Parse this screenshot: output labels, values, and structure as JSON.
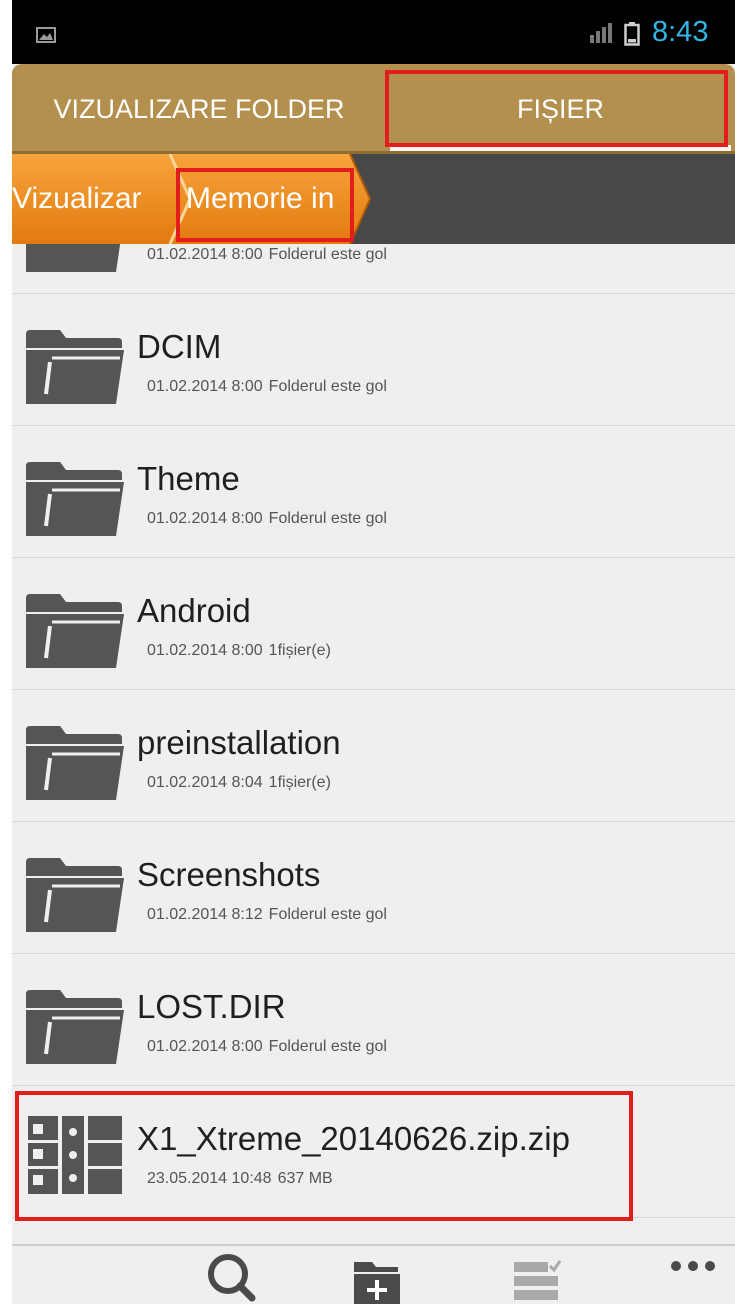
{
  "status_bar": {
    "time": "8:43"
  },
  "tabs": [
    {
      "label": "VIZUALIZARE FOLDER",
      "active": false
    },
    {
      "label": "FIȘIER",
      "active": true
    }
  ],
  "breadcrumb": [
    "Vizualizar",
    "Memorie in"
  ],
  "files": [
    {
      "name": "",
      "date": "01.02.2014 8:00",
      "info": "Folderul este gol",
      "type": "folder",
      "partial": true
    },
    {
      "name": "DCIM",
      "date": "01.02.2014 8:00",
      "info": "Folderul este gol",
      "type": "folder"
    },
    {
      "name": "Theme",
      "date": "01.02.2014 8:00",
      "info": "Folderul este gol",
      "type": "folder"
    },
    {
      "name": "Android",
      "date": "01.02.2014 8:00",
      "info": "1fișier(e)",
      "type": "folder"
    },
    {
      "name": "preinstallation",
      "date": "01.02.2014 8:04",
      "info": "1fișier(e)",
      "type": "folder"
    },
    {
      "name": "Screenshots",
      "date": "01.02.2014 8:12",
      "info": "Folderul este gol",
      "type": "folder"
    },
    {
      "name": "LOST.DIR",
      "date": "01.02.2014 8:00",
      "info": "Folderul este gol",
      "type": "folder"
    },
    {
      "name": "X1_Xtreme_20140626.zip.zip",
      "date": "23.05.2014 10:48",
      "info": "637 MB",
      "type": "archive"
    }
  ],
  "bottom_bar": {
    "icons": [
      "search-icon",
      "new-folder-icon",
      "multi-select-icon",
      "more-icon"
    ]
  },
  "colors": {
    "accent": "#33b5e5",
    "tab_bg": "#b4904f",
    "breadcrumb": "#f0901e",
    "highlight": "#e31c1c"
  }
}
